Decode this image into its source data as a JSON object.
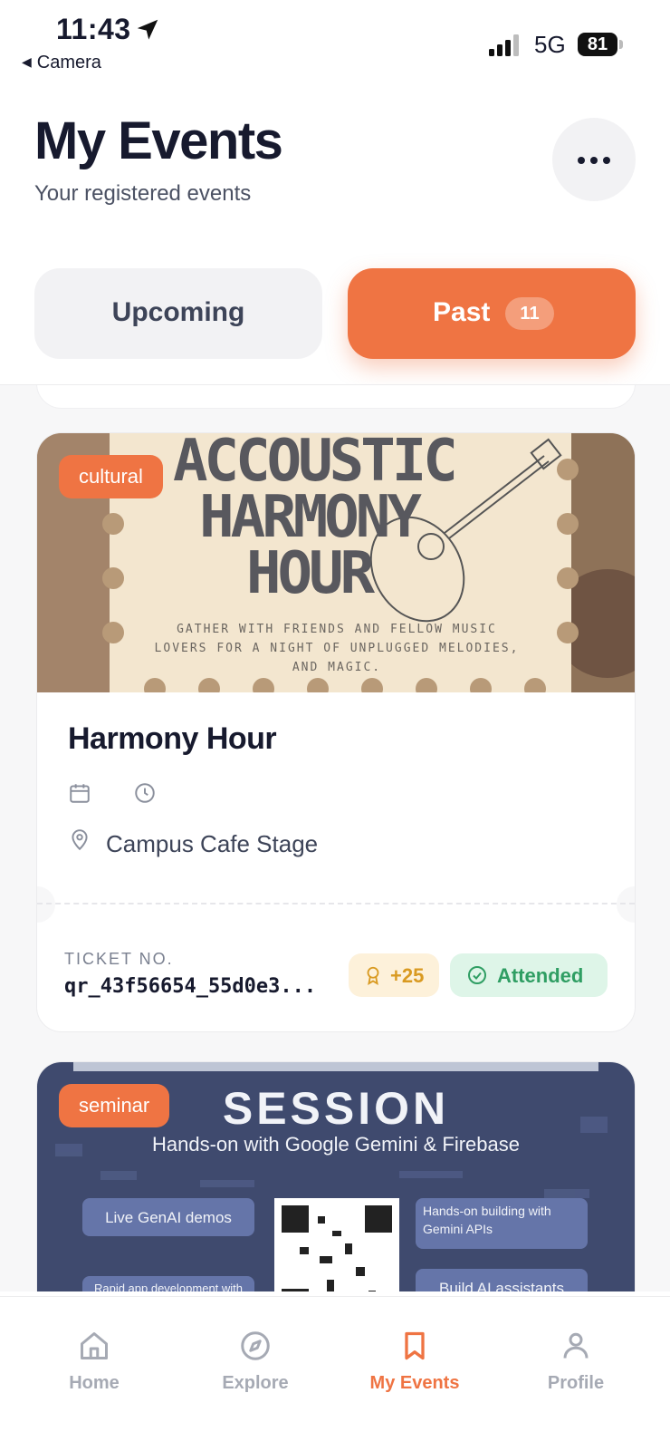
{
  "status_bar": {
    "time": "11:43",
    "back_label": "Camera",
    "network": "5G",
    "battery": "81"
  },
  "header": {
    "title": "My Events",
    "subtitle": "Your registered events"
  },
  "tabs": {
    "upcoming_label": "Upcoming",
    "past_label": "Past",
    "past_count": "11"
  },
  "events": [
    {
      "category": "cultural",
      "poster": {
        "line1": "ACCOUSTIC",
        "line2": "HARMONY",
        "line3": "HOUR",
        "tagline1": "GATHER WITH FRIENDS AND FELLOW MUSIC",
        "tagline2": "LOVERS FOR A NIGHT OF UNPLUGGED MELODIES,",
        "tagline3": "AND MAGIC."
      },
      "title": "Harmony Hour",
      "venue": "Campus Cafe Stage",
      "ticket_label": "TICKET NO.",
      "ticket_number": "qr_43f56654_55d0e3...",
      "points": "+25",
      "status": "Attended"
    },
    {
      "category": "seminar",
      "poster": {
        "heading": "SESSION",
        "subheading": "Hands-on with Google Gemini & Firebase",
        "pill1": "Live GenAI demos",
        "pill2": "Hands-on building with Gemini APIs",
        "pill3": "Rapid app development with",
        "pill4": "Build AI assistants"
      }
    }
  ],
  "bottom_nav": {
    "home": "Home",
    "explore": "Explore",
    "my_events": "My Events",
    "profile": "Profile"
  },
  "colors": {
    "accent": "#ef7443",
    "attended_bg": "#def5e8",
    "attended_fg": "#2f9e63",
    "points_bg": "#fdf1da",
    "points_fg": "#d99a21"
  }
}
